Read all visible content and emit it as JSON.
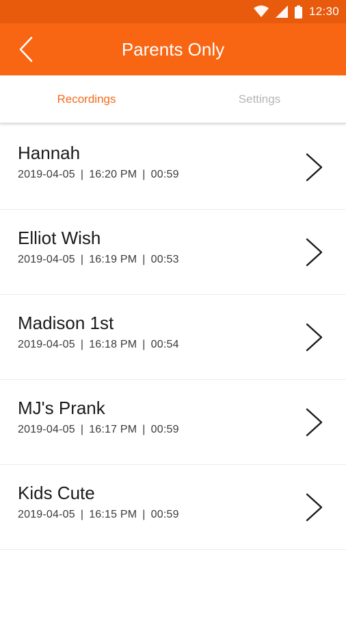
{
  "status_bar": {
    "time": "12:30",
    "icons": [
      "wifi-icon",
      "signal-icon",
      "battery-icon"
    ]
  },
  "app_bar": {
    "title": "Parents Only",
    "back_icon": "chevron-left-icon"
  },
  "tabs": [
    {
      "label": "Recordings",
      "active": true
    },
    {
      "label": "Settings",
      "active": false
    }
  ],
  "recordings": [
    {
      "name": "Hannah",
      "date": "2019-04-05",
      "time": "16:20 PM",
      "duration": "00:59"
    },
    {
      "name": "Elliot Wish",
      "date": "2019-04-05",
      "time": "16:19 PM",
      "duration": "00:53"
    },
    {
      "name": "Madison 1st",
      "date": "2019-04-05",
      "time": "16:18 PM",
      "duration": "00:54"
    },
    {
      "name": "MJ's Prank",
      "date": "2019-04-05",
      "time": "16:17 PM",
      "duration": "00:59"
    },
    {
      "name": "Kids Cute",
      "date": "2019-04-05",
      "time": "16:15 PM",
      "duration": "00:59"
    }
  ],
  "meta_separator": "|",
  "colors": {
    "status_bar": "#e85a0c",
    "app_bar": "#f86614",
    "active_tab": "#f26a1b",
    "inactive_tab": "#b5b5b5"
  }
}
